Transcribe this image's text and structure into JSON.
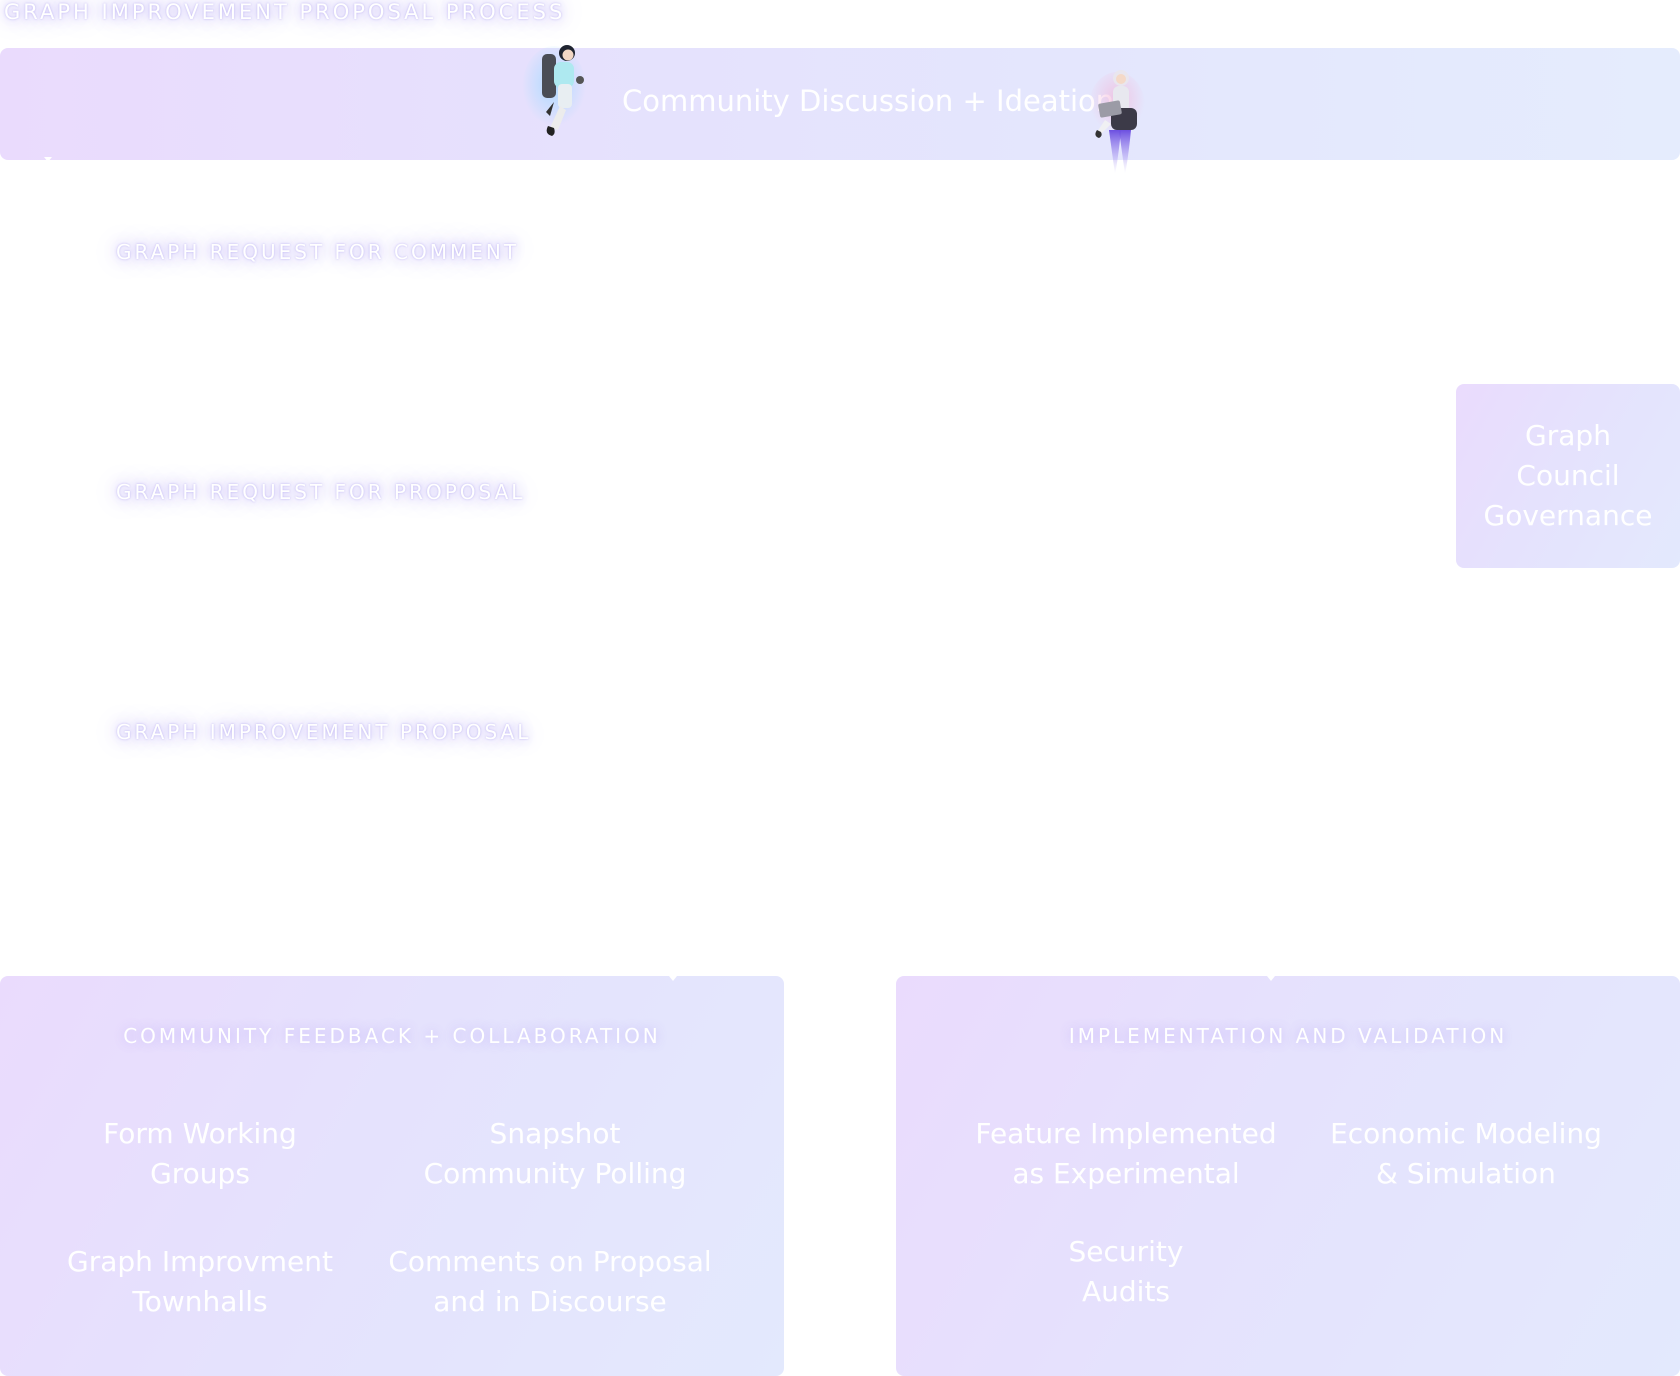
{
  "header_label": "GRAPH IMPROVEMENT PROPOSAL PROCESS",
  "top_bar": {
    "title": "Community Discussion + Ideation"
  },
  "stage_labels": {
    "rfc": "GRAPH REQUEST FOR COMMENT",
    "rfp": "GRAPH REQUEST FOR PROPOSAL",
    "gip": "GRAPH IMPROVEMENT PROPOSAL"
  },
  "council_box": {
    "label": "Graph\nCouncil\nGovernance"
  },
  "feedback_panel": {
    "heading": "COMMUNITY FEEDBACK + COLLABORATION",
    "items": [
      "Form Working\nGroups",
      "Snapshot\nCommunity Polling",
      "Graph Improvment\nTownhalls",
      "Comments on Proposal\nand in Discourse"
    ]
  },
  "implementation_panel": {
    "heading": "IMPLEMENTATION AND VALIDATION",
    "items": [
      "Feature Implemented\nas Experimental",
      "Economic Modeling\n& Simulation",
      "Security\nAudits"
    ]
  },
  "illustrations": [
    "astronaut-jetpack-figure",
    "astronaut-laptop-figure"
  ],
  "colors": {
    "gradient_start": "#eadbfd",
    "gradient_mid": "#e5e2fd",
    "gradient_end": "#e4eafd",
    "text": "#ffffff",
    "glow": "#b9aaf5"
  }
}
